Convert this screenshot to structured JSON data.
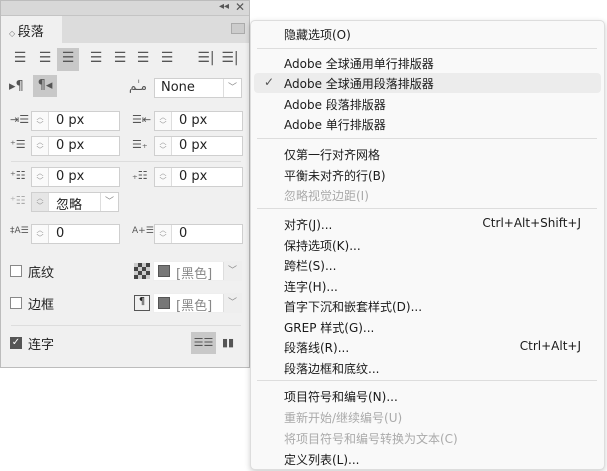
{
  "panel": {
    "title": "段落",
    "indent_fields": [
      "0 px",
      "0 px",
      "0 px",
      "0 px",
      "0 px",
      "0 px"
    ],
    "direction_select": "None",
    "ignore_select": "忽略",
    "drop_cap_lines": "0",
    "drop_cap_chars": "0",
    "shading_label": "底纹",
    "shading_color": "[黑色]",
    "border_label": "边框",
    "border_color": "[黑色]",
    "hyphenate_label": "连字",
    "hyphenate_checked": true
  },
  "menu": {
    "items": [
      {
        "label": "隐藏选项(O)"
      },
      {
        "label": "Adobe 全球通用单行排版器"
      },
      {
        "label": "Adobe 全球通用段落排版器",
        "checked": true
      },
      {
        "label": "Adobe 段落排版器"
      },
      {
        "label": "Adobe 单行排版器"
      },
      {
        "label": "仅第一行对齐网格"
      },
      {
        "label": "平衡未对齐的行(B)"
      },
      {
        "label": "忽略视觉边距(I)",
        "disabled": true
      },
      {
        "label": "对齐(J)...",
        "shortcut": "Ctrl+Alt+Shift+J"
      },
      {
        "label": "保持选项(K)..."
      },
      {
        "label": "跨栏(S)..."
      },
      {
        "label": "连字(H)..."
      },
      {
        "label": "首字下沉和嵌套样式(D)..."
      },
      {
        "label": "GREP 样式(G)..."
      },
      {
        "label": "段落线(R)...",
        "shortcut": "Ctrl+Alt+J"
      },
      {
        "label": "段落边框和底纹..."
      },
      {
        "label": "项目符号和编号(N)..."
      },
      {
        "label": "重新开始/继续编号(U)",
        "disabled": true
      },
      {
        "label": "将项目符号和编号转换为文本(C)",
        "disabled": true
      },
      {
        "label": "定义列表(L)..."
      }
    ]
  }
}
